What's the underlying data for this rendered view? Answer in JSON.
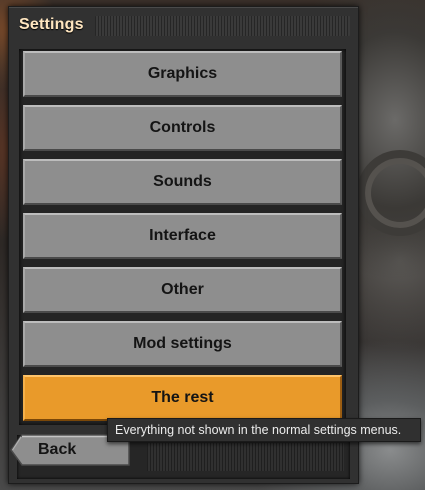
{
  "window": {
    "title": "Settings"
  },
  "menu": {
    "items": [
      {
        "label": "Graphics",
        "active": false
      },
      {
        "label": "Controls",
        "active": false
      },
      {
        "label": "Sounds",
        "active": false
      },
      {
        "label": "Interface",
        "active": false
      },
      {
        "label": "Other",
        "active": false
      },
      {
        "label": "Mod settings",
        "active": false
      },
      {
        "label": "The rest",
        "active": true
      }
    ]
  },
  "footer": {
    "back_label": "Back"
  },
  "tooltip": {
    "text": "Everything not shown in the normal settings menus."
  },
  "colors": {
    "button_gray": "#8e8e8e",
    "button_active_orange": "#e99a2a",
    "title_text": "#ffe6c0"
  }
}
